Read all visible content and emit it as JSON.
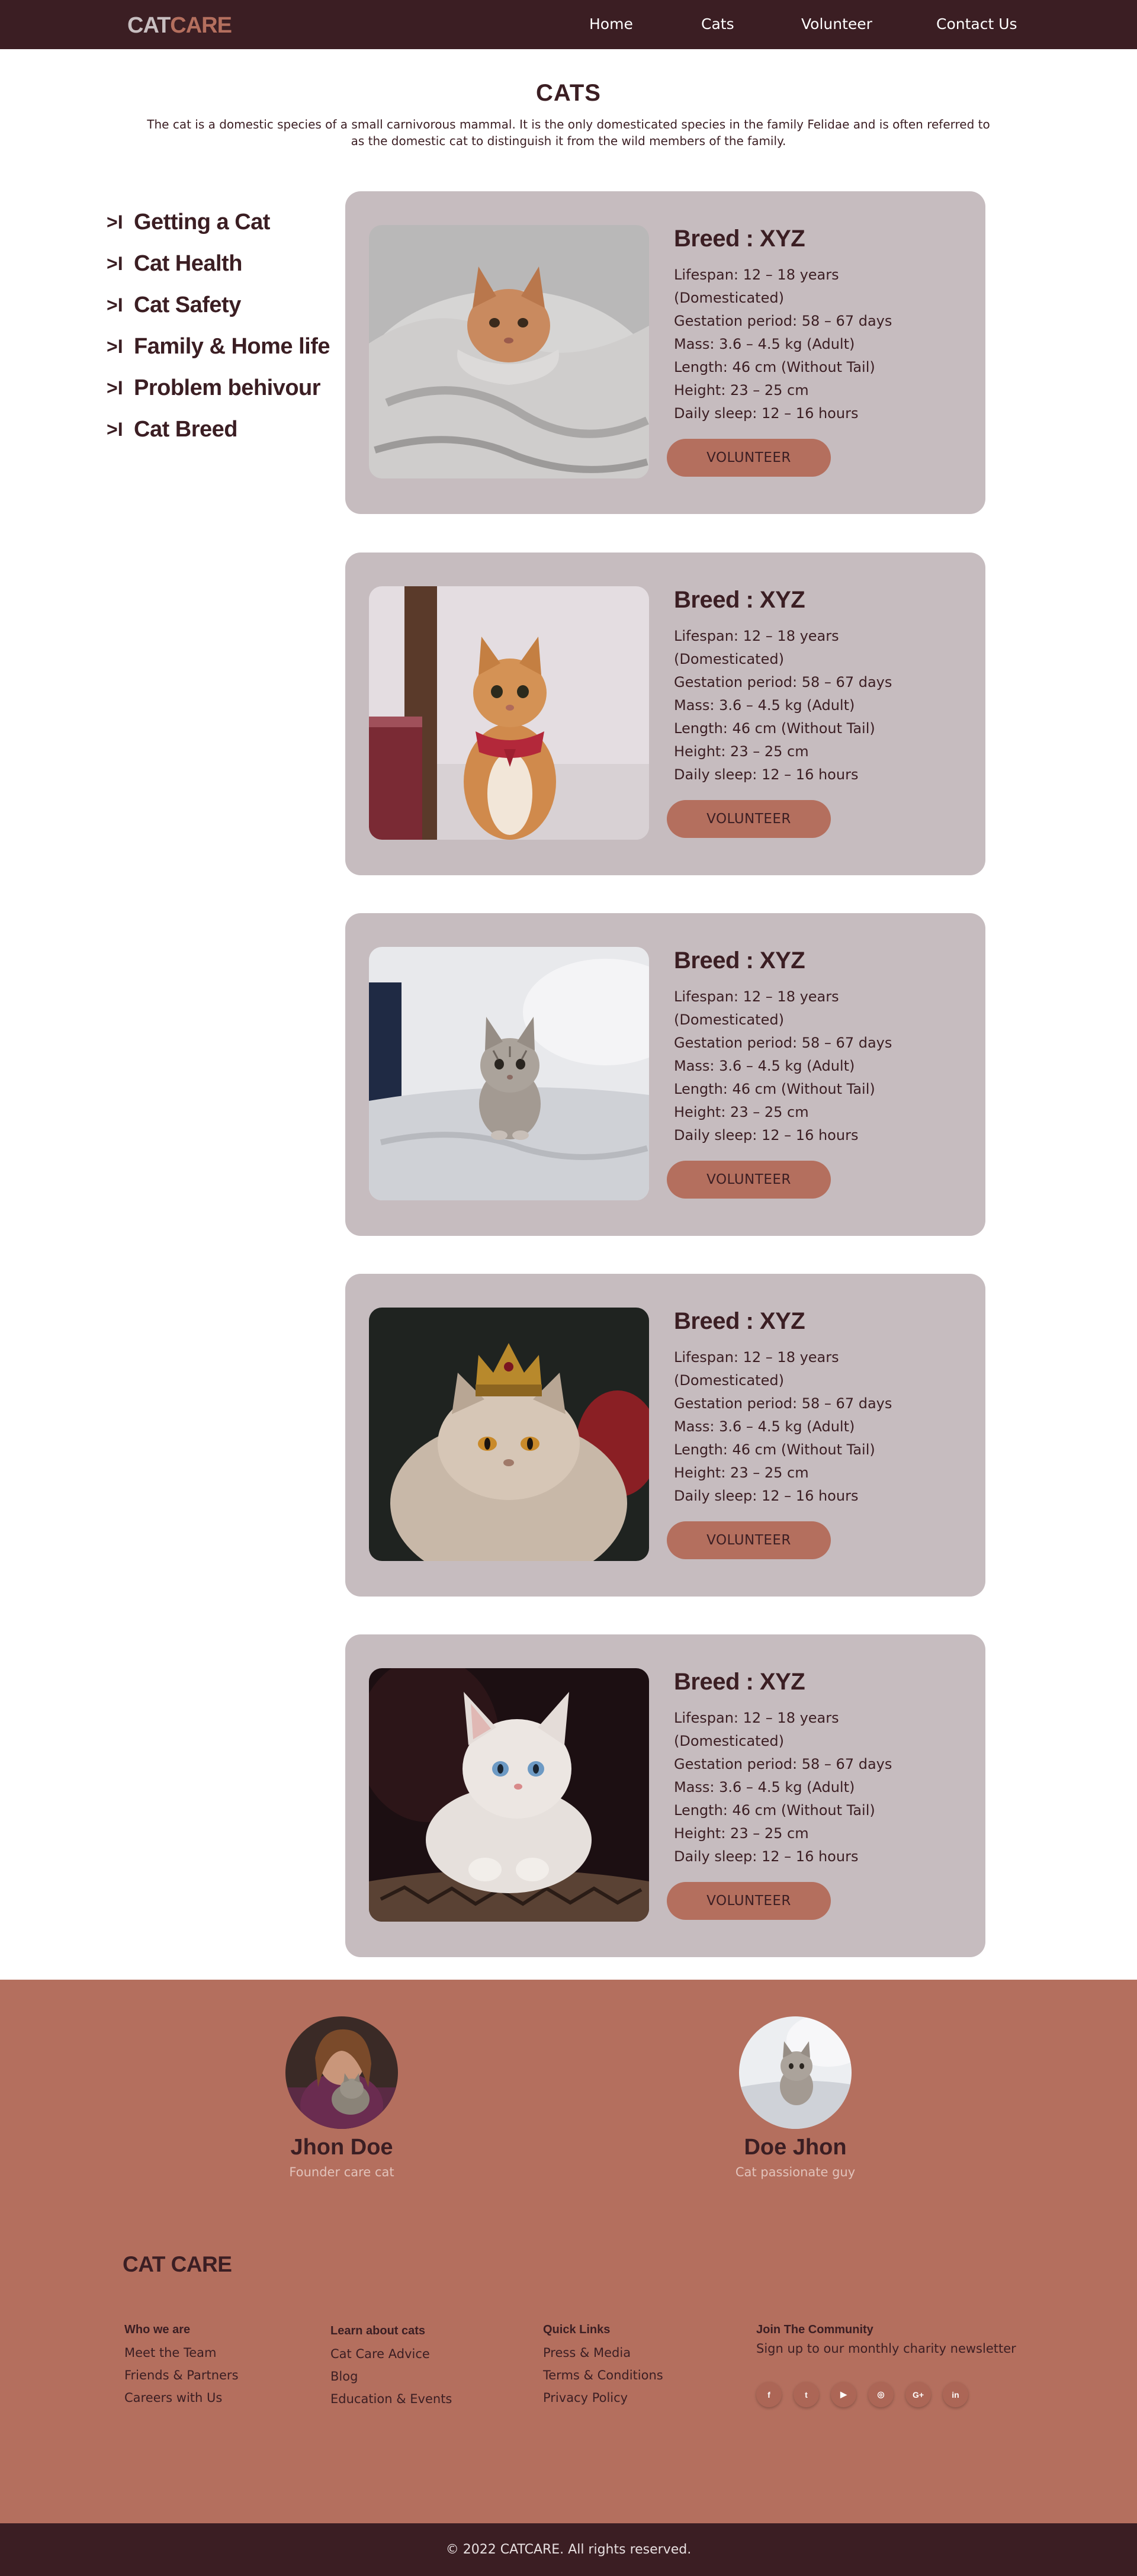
{
  "nav": {
    "logo_part1": "CAT",
    "logo_part2": "CARE",
    "links": [
      "Home",
      "Cats",
      "Volunteer",
      "Contact Us"
    ]
  },
  "hero": {
    "title": "CATS",
    "description": "The cat is a domestic species of a small carnivorous mammal. It is the only domesticated species in the family Felidae and is often referred to as the domestic cat to distinguish it from the wild members of the family."
  },
  "sidebar": {
    "arrow": ">I",
    "items": [
      "Getting a Cat",
      "Cat Health",
      "Cat Safety",
      "Family & Home life",
      "Problem behivour",
      "Cat Breed"
    ]
  },
  "card_common": {
    "breed": "Breed : XYZ",
    "facts": [
      "Lifespan: 12 – 18 years",
      "(Domesticated)",
      "Gestation period: 58 – 67 days",
      "Mass: 3.6 – 4.5 kg (Adult)",
      "Length: 46 cm (Without Tail)",
      "Height: 23 – 25 cm",
      "Daily sleep: 12 – 16 hours"
    ],
    "button": "VOLUNTEER"
  },
  "cards": [
    {
      "photo": "orange-kitten-in-blanket-photo"
    },
    {
      "photo": "orange-cat-with-red-bandana-photo"
    },
    {
      "photo": "grey-tabby-kitten-on-bed-photo"
    },
    {
      "photo": "cat-wearing-gold-crown-photo"
    },
    {
      "photo": "white-blue-eyed-kitten-photo"
    }
  ],
  "team": [
    {
      "name": "Jhon Doe",
      "role": "Founder care cat"
    },
    {
      "name": "Doe Jhon",
      "role": "Cat passionate guy"
    }
  ],
  "footer": {
    "logo": "CAT CARE",
    "columns": [
      {
        "heading": "Who we are",
        "links": [
          "Meet the Team",
          "Friends & Partners",
          "Careers with Us"
        ]
      },
      {
        "heading": "Learn about cats",
        "links": [
          "Cat Care Advice",
          "Blog",
          "Education & Events"
        ]
      },
      {
        "heading": "Quick Links",
        "links": [
          "Press & Media",
          "Terms & Conditions",
          "Privacy Policy"
        ]
      }
    ],
    "community": {
      "heading": "Join The Community",
      "text": "Sign up to our monthly charity newsletter",
      "socials": [
        "f",
        "t",
        "▶",
        "◎",
        "G+",
        "in"
      ],
      "social_icons": [
        "facebook-icon",
        "twitter-icon",
        "youtube-icon",
        "instagram-icon",
        "google-plus-icon",
        "linkedin-icon"
      ]
    },
    "copyright": "© 2022 CATCARE. All rights reserved."
  },
  "colors": {
    "nav_bg": "#3b1e23",
    "accent": "#b46f5e",
    "card_bg": "#c6bcbf",
    "text_dark": "#3b1e23"
  }
}
